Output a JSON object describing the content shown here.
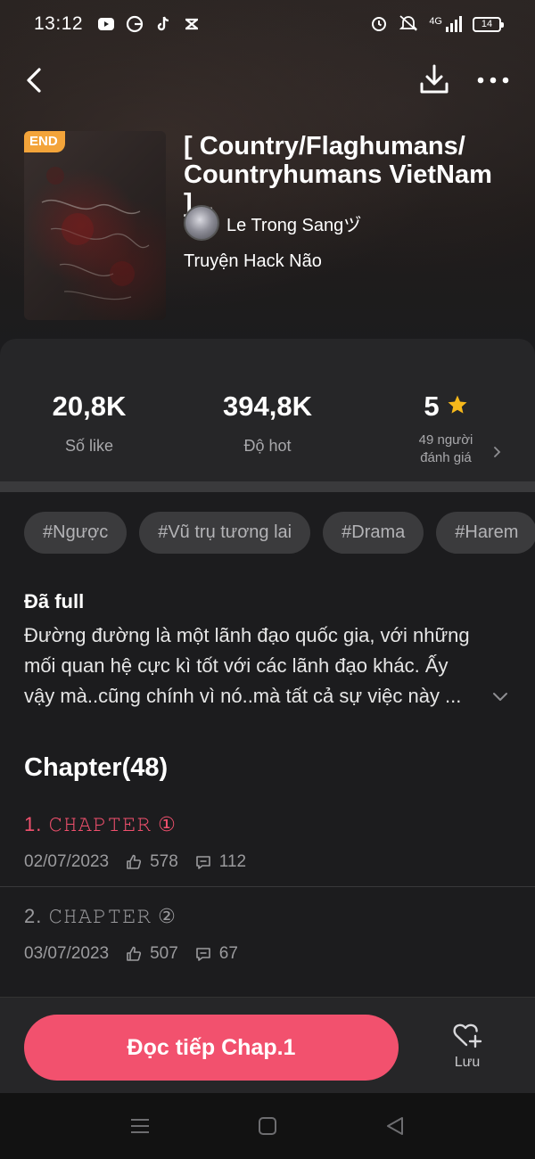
{
  "status_bar": {
    "time": "13:12",
    "network": "4G",
    "battery": "14",
    "app_icons": [
      "youtube-icon",
      "g-icon",
      "tiktok-icon",
      "capcut-icon"
    ]
  },
  "story": {
    "badge": "END",
    "title": "[ Country/Flaghumans/ Countryhumans VietNam ]...",
    "author": "Le Trong Sangヅ",
    "category": "Truyện Hack Não"
  },
  "stats": {
    "likes_value": "20,8K",
    "likes_label": "Số like",
    "hot_value": "394,8K",
    "hot_label": "Độ hot",
    "rating_value": "5",
    "rating_label_line1": "49 người",
    "rating_label_line2": "đánh giá"
  },
  "tags": [
    "#Ngược",
    "#Vũ trụ tương lai",
    "#Drama",
    "#Harem"
  ],
  "description": {
    "status": "Đã full",
    "line1": "Đường đường là một lãnh đạo quốc gia, với những",
    "line2": "mối quan hệ cực kì tốt với các lãnh đạo khác. Ấy",
    "line3": "vậy mà..cũng chính vì nó..mà tất cả sự việc này ..."
  },
  "chapters": {
    "heading": "Chapter(48)",
    "items": [
      {
        "title": "1. 𝙲𝙷𝙰𝙿𝚃𝙴𝚁 ①",
        "date": "02/07/2023",
        "likes": "578",
        "comments": "112",
        "active": true
      },
      {
        "title": "2. 𝙲𝙷𝙰𝙿𝚃𝙴𝚁 ②",
        "date": "03/07/2023",
        "likes": "507",
        "comments": "67",
        "active": false
      }
    ]
  },
  "actions": {
    "read_label": "Đọc tiếp Chap.1",
    "save_label": "Lưu"
  },
  "colors": {
    "accent": "#f2516e",
    "badge": "#f3a43a",
    "star": "#f6b81b"
  }
}
